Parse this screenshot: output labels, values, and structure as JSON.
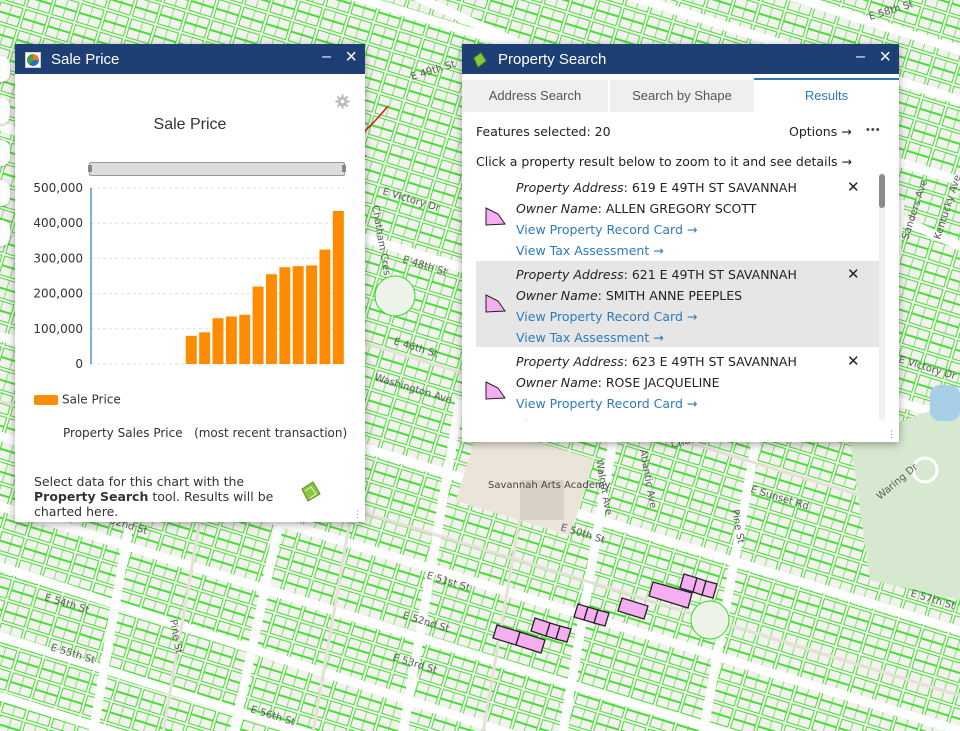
{
  "map": {
    "streets": {
      "e_58th": "E 58th St",
      "e_49th": "E 49th St",
      "e_victory_top": "E Victory Dr",
      "e_victory_right": "E Victory Dr",
      "chatham_cres": "Chatham Cres",
      "e_46th": "E 46th St",
      "e_48th": "E 48th St",
      "washington": "Washington Ave",
      "sanders": "Sanders Ave",
      "e_50th": "E 50th St",
      "e_51st": "E 51st St",
      "e_52nd": "E 52nd St",
      "e_52nd_left": "E 52nd St",
      "e_53rd": "E 53rd St",
      "e_54th": "E 54th St",
      "e_55th": "E 55th St",
      "e_56th": "E 56th St",
      "pine_left": "Pine St",
      "pine_right": "Pine St",
      "atlantic": "Atlantic Ave",
      "walnut": "Walnut Ave",
      "waring": "Waring Dr",
      "chatham_rd": "Chatham Rd",
      "e_sunset": "E Sunset Rd",
      "e_57th": "E 57th St",
      "kentucky": "Kentucky Ave"
    },
    "landmark": "Savannah Arts Academy"
  },
  "sale_price_panel": {
    "title": "Sale Price",
    "chart_footer": "Property Sales Price   (most recent transaction)",
    "help_prefix": "Select data for this chart with the ",
    "help_tool": "Property Search",
    "help_suffix": " tool. Results will be charted here."
  },
  "chart_data": {
    "type": "bar",
    "title": "Sale Price",
    "xlabel": "",
    "ylabel": "",
    "ylim": [
      0,
      500000
    ],
    "y_ticks": [
      "500,000",
      "400,000",
      "300,000",
      "200,000",
      "100,000",
      "0"
    ],
    "series": [
      {
        "name": "Sale Price",
        "color": "#ff8b00",
        "values": [
          0,
          0,
          0,
          0,
          0,
          0,
          0,
          80000,
          90000,
          130000,
          135000,
          140000,
          220000,
          255000,
          275000,
          278000,
          280000,
          325000,
          435000
        ]
      }
    ],
    "legend": "bottom-left",
    "grid": true
  },
  "property_search_panel": {
    "title": "Property Search",
    "tabs": [
      "Address Search",
      "Search by Shape",
      "Results"
    ],
    "active_tab": "Results",
    "features_selected": "Features selected: 20",
    "options_label": "Options →",
    "more_label": "•••",
    "instruction": "Click a property result below to zoom to it and see details →",
    "address_label": "Property Address",
    "owner_label": "Owner Name",
    "record_link": "View Property Record Card →",
    "tax_link": "View Tax Assessment →",
    "results": [
      {
        "address": "619 E 49TH ST SAVANNAH",
        "owner": "ALLEN GREGORY SCOTT",
        "highlighted": false
      },
      {
        "address": "621 E 49TH ST SAVANNAH",
        "owner": "SMITH ANNE PEEPLES",
        "highlighted": true
      },
      {
        "address": "623 E 49TH ST SAVANNAH",
        "owner": "ROSE JACQUELINE",
        "highlighted": false
      }
    ]
  },
  "colors": {
    "titlebar": "#1e3f73",
    "parcel_line": "#33dd22",
    "selected_parcel": "#f5aef0",
    "link": "#2e7bb8",
    "bar": "#ff8b00"
  }
}
